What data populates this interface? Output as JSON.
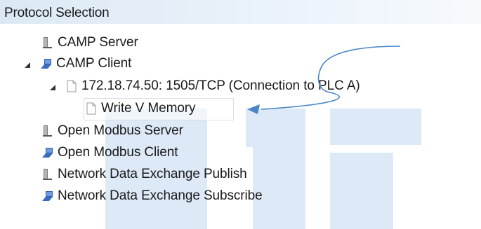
{
  "header": {
    "title": "Protocol Selection"
  },
  "tree": {
    "items": [
      {
        "label": "CAMP Server"
      },
      {
        "label": "CAMP Client"
      },
      {
        "label": "172.18.74.50: 1505/TCP (Connection to PLC A)"
      },
      {
        "label": "Write V Memory"
      },
      {
        "label": "Open Modbus Server"
      },
      {
        "label": "Open Modbus Client"
      },
      {
        "label": "Network Data Exchange Publish"
      },
      {
        "label": "Network Data Exchange Subscribe"
      }
    ]
  },
  "colors": {
    "header_bg": "#dce9f5",
    "watermark": "#dde9f6",
    "annotation_arrow": "#4a86c8",
    "server_icon": "#6e6e6e",
    "client_icon": "#2f5fb0"
  },
  "icons": {
    "server": "server-tower-icon",
    "client": "network-computer-icon",
    "document": "document-icon",
    "expanded": "expanded-triangle-icon"
  }
}
